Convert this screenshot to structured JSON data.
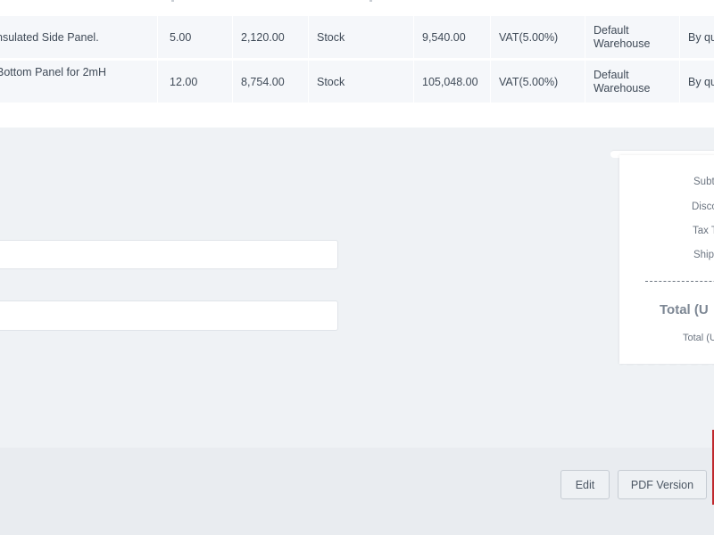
{
  "items_table": {
    "rows": [
      {
        "description": "nsulated Side Panel.",
        "quantity": "5.00",
        "rate": "2,120.00",
        "item_type": "Stock",
        "amount": "9,540.00",
        "tax": "VAT(5.00%)",
        "warehouse": "Default Warehouse",
        "discount_type": "By qu"
      },
      {
        "description": "Bottom Panel for 2mH",
        "quantity": "12.00",
        "rate": "8,754.00",
        "item_type": "Stock",
        "amount": "105,048.00",
        "tax": "VAT(5.00%)",
        "warehouse": "Default Warehouse",
        "discount_type": "By qu"
      }
    ]
  },
  "summary": {
    "subtotal_label": "Subt",
    "discount_label": "Disco",
    "tax_label": "Tax T",
    "shipping_label": "Ship",
    "total_label": "Total (U",
    "total_words_label": "Total (U"
  },
  "actions": {
    "edit_label": "Edit",
    "pdf_label": "PDF Version"
  },
  "colors": {
    "accent_edge": "#c0282d",
    "background": "#eff2f5"
  }
}
